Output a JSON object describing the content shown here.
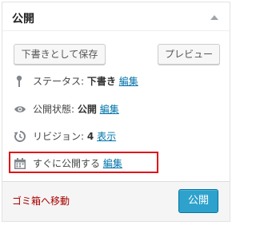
{
  "panel": {
    "title": "公開"
  },
  "buttons": {
    "save_draft": "下書きとして保存",
    "preview": "プレビュー",
    "publish": "公開"
  },
  "status": {
    "label": "ステータス:",
    "value": "下書き",
    "edit": "編集",
    "icon": "pin-icon"
  },
  "visibility": {
    "label": "公開状態:",
    "value": "公開",
    "edit": "編集",
    "icon": "eye-icon"
  },
  "revision": {
    "label": "リビジョン:",
    "value": "4",
    "view": "表示",
    "icon": "history-icon"
  },
  "schedule": {
    "label": "すぐに公開する",
    "edit": "編集",
    "icon": "calendar-icon"
  },
  "footer": {
    "trash": "ゴミ箱へ移動"
  },
  "colors": {
    "link": "#0073aa",
    "trash": "#aa0000",
    "publish_button": "#2ea2cc",
    "highlight": "#e0121a"
  }
}
